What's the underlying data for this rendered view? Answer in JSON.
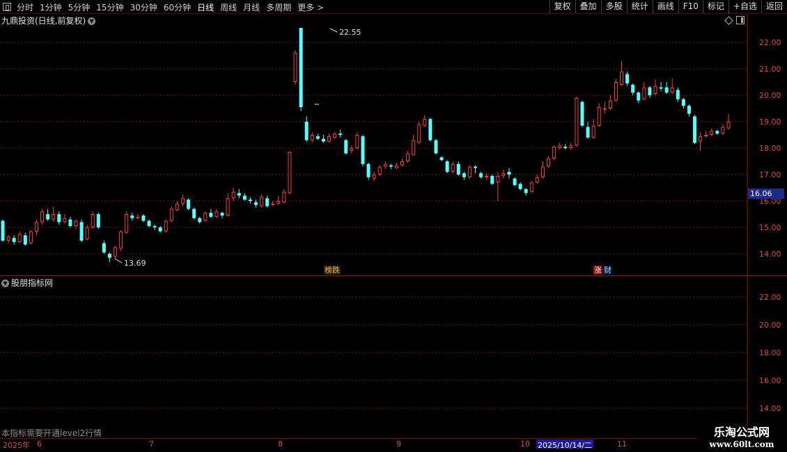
{
  "toolbar": {
    "items": [
      "分时",
      "1分钟",
      "5分钟",
      "15分钟",
      "30分钟",
      "60分钟",
      "日线",
      "周线",
      "月线",
      "多周期",
      "更多 >"
    ],
    "active_index": 6,
    "right_buttons": [
      "复权",
      "叠加",
      "多股",
      "统计",
      "画线",
      "F10",
      "标记",
      "+自选",
      "返回"
    ]
  },
  "main_chart": {
    "title": "九鼎投资(日线,前复权)",
    "y_axis_labels": [
      "22.00",
      "21.00",
      "20.00",
      "19.00",
      "18.00",
      "17.00",
      "16.00",
      "15.00",
      "14.00"
    ],
    "current_price_label": "16.06",
    "high_label": "22.55",
    "low_label": "13.69",
    "tag_bang": "榜跌",
    "tag_zhang": "涨",
    "tag_cai": "财"
  },
  "indicator": {
    "title": "股朋指标网",
    "y_axis_labels": [
      "22.00",
      "20.00",
      "18.00",
      "16.00",
      "14.00"
    ],
    "notice": "本指标需要开通level2行情"
  },
  "date_axis": {
    "year_label": "2025年",
    "months": [
      "6",
      "7",
      "8",
      "9",
      "10",
      "11"
    ],
    "highlight_date": "2025/10/14/二"
  },
  "watermark": {
    "line1": "乐淘公式网",
    "line2": "www.60lt.com"
  },
  "colors": {
    "up": "#ff3b3b",
    "down": "#54ffff",
    "grid": "#7a1010",
    "axis_text": "#e04040"
  },
  "chart_data": {
    "type": "candlestick",
    "ylim": [
      13.3,
      23.0
    ],
    "candles": [
      [
        15.25,
        14.5,
        15.3,
        14.45
      ],
      [
        14.5,
        14.65,
        14.7,
        14.4
      ],
      [
        14.6,
        14.45,
        14.7,
        14.35
      ],
      [
        14.45,
        14.75,
        14.85,
        14.4
      ],
      [
        14.7,
        14.35,
        14.8,
        14.3
      ],
      [
        14.4,
        14.85,
        14.9,
        14.35
      ],
      [
        14.85,
        15.2,
        15.3,
        14.7
      ],
      [
        15.2,
        15.6,
        15.7,
        15.1
      ],
      [
        15.5,
        15.3,
        15.7,
        15.25
      ],
      [
        15.3,
        15.5,
        15.8,
        15.2
      ],
      [
        15.5,
        15.2,
        15.6,
        15.1
      ],
      [
        15.2,
        15.35,
        15.5,
        15.15
      ],
      [
        15.3,
        15.05,
        15.4,
        15.0
      ],
      [
        15.05,
        15.25,
        15.3,
        14.95
      ],
      [
        15.2,
        14.5,
        15.3,
        14.45
      ],
      [
        14.55,
        15.0,
        15.1,
        14.5
      ],
      [
        15.0,
        15.5,
        15.6,
        14.95
      ],
      [
        15.5,
        15.0,
        15.55,
        14.95
      ],
      [
        14.4,
        14.05,
        14.5,
        14.0
      ],
      [
        14.0,
        13.85,
        14.05,
        13.69
      ],
      [
        13.9,
        14.25,
        14.3,
        13.8
      ],
      [
        14.2,
        14.85,
        14.9,
        14.1
      ],
      [
        14.8,
        15.5,
        15.6,
        14.75
      ],
      [
        15.45,
        15.35,
        15.55,
        15.25
      ],
      [
        15.35,
        15.4,
        15.5,
        15.3
      ],
      [
        15.45,
        15.25,
        15.5,
        15.2
      ],
      [
        15.25,
        15.05,
        15.3,
        15.0
      ],
      [
        15.05,
        15.0,
        15.1,
        14.9
      ],
      [
        15.0,
        14.85,
        15.05,
        14.8
      ],
      [
        14.85,
        15.25,
        15.3,
        14.8
      ],
      [
        15.25,
        15.7,
        15.8,
        15.2
      ],
      [
        15.65,
        15.9,
        16.0,
        15.6
      ],
      [
        15.9,
        16.1,
        16.25,
        15.8
      ],
      [
        16.05,
        15.7,
        16.1,
        15.65
      ],
      [
        15.7,
        15.35,
        15.75,
        15.3
      ],
      [
        15.35,
        15.2,
        15.4,
        15.15
      ],
      [
        15.25,
        15.55,
        15.6,
        15.2
      ],
      [
        15.55,
        15.4,
        15.7,
        15.35
      ],
      [
        15.4,
        15.6,
        15.7,
        15.35
      ],
      [
        15.55,
        15.45,
        15.6,
        15.35
      ],
      [
        15.45,
        16.1,
        16.3,
        15.4
      ],
      [
        16.1,
        16.35,
        16.5,
        16.0
      ],
      [
        16.3,
        16.2,
        16.45,
        16.1
      ],
      [
        16.2,
        16.05,
        16.3,
        16.0
      ],
      [
        16.05,
        16.0,
        16.15,
        15.9
      ],
      [
        15.95,
        15.85,
        16.05,
        15.75
      ],
      [
        15.8,
        16.15,
        16.25,
        15.75
      ],
      [
        16.1,
        15.8,
        16.2,
        15.75
      ],
      [
        15.85,
        15.9,
        16.0,
        15.8
      ],
      [
        15.9,
        16.0,
        16.2,
        15.85
      ],
      [
        15.95,
        16.35,
        16.45,
        15.9
      ],
      [
        16.3,
        17.85,
        17.9,
        16.25
      ],
      [
        20.5,
        21.6,
        21.7,
        20.4
      ],
      [
        22.55,
        19.55,
        22.55,
        19.4
      ],
      [
        19.0,
        18.3,
        19.2,
        18.25
      ],
      [
        18.3,
        18.5,
        18.6,
        18.2
      ],
      [
        18.45,
        18.35,
        18.55,
        18.3
      ],
      [
        18.35,
        18.25,
        18.5,
        18.2
      ],
      [
        18.25,
        18.45,
        18.55,
        18.2
      ],
      [
        18.4,
        18.55,
        18.6,
        18.35
      ],
      [
        18.55,
        18.5,
        18.7,
        18.4
      ],
      [
        18.3,
        17.8,
        18.35,
        17.75
      ],
      [
        17.9,
        18.0,
        18.1,
        17.8
      ],
      [
        18.0,
        18.5,
        18.6,
        17.95
      ],
      [
        18.45,
        17.4,
        18.5,
        17.3
      ],
      [
        17.4,
        16.9,
        17.45,
        16.8
      ],
      [
        16.85,
        17.0,
        17.1,
        16.75
      ],
      [
        17.0,
        17.3,
        17.35,
        16.95
      ],
      [
        17.3,
        17.4,
        17.5,
        17.2
      ],
      [
        17.35,
        17.3,
        17.4,
        17.2
      ],
      [
        17.25,
        17.35,
        17.45,
        17.2
      ],
      [
        17.35,
        17.5,
        17.6,
        17.3
      ],
      [
        17.5,
        17.8,
        17.9,
        17.45
      ],
      [
        17.75,
        18.3,
        18.5,
        17.7
      ],
      [
        18.2,
        18.9,
        19.0,
        18.15
      ],
      [
        18.85,
        19.1,
        19.25,
        18.8
      ],
      [
        19.1,
        18.3,
        19.15,
        18.25
      ],
      [
        18.3,
        17.8,
        18.35,
        17.75
      ],
      [
        17.65,
        17.55,
        17.7,
        17.5
      ],
      [
        17.5,
        17.1,
        17.55,
        17.05
      ],
      [
        17.1,
        17.4,
        17.5,
        17.05
      ],
      [
        17.4,
        17.0,
        17.5,
        16.95
      ],
      [
        17.05,
        16.9,
        17.1,
        16.8
      ],
      [
        16.9,
        17.3,
        17.35,
        16.85
      ],
      [
        17.3,
        17.25,
        17.35,
        17.05
      ],
      [
        17.05,
        16.9,
        17.1,
        16.85
      ],
      [
        16.9,
        16.95,
        17.05,
        16.8
      ],
      [
        16.95,
        16.65,
        17.0,
        16.6
      ],
      [
        16.7,
        16.95,
        17.1,
        16.0
      ],
      [
        16.95,
        17.05,
        17.2,
        16.85
      ],
      [
        17.1,
        17.0,
        17.25,
        16.85
      ],
      [
        16.85,
        16.6,
        16.9,
        16.55
      ],
      [
        16.65,
        16.45,
        16.7,
        16.4
      ],
      [
        16.45,
        16.3,
        16.5,
        16.2
      ],
      [
        16.35,
        16.7,
        16.75,
        16.3
      ],
      [
        16.7,
        16.9,
        17.0,
        16.65
      ],
      [
        16.9,
        17.3,
        17.5,
        16.85
      ],
      [
        17.3,
        17.6,
        17.7,
        17.25
      ],
      [
        17.6,
        18.05,
        18.1,
        17.55
      ],
      [
        18.0,
        18.1,
        18.2,
        17.95
      ],
      [
        18.05,
        18.0,
        18.15,
        17.95
      ],
      [
        18.0,
        18.1,
        18.2,
        17.95
      ],
      [
        18.1,
        19.9,
        19.95,
        18.05
      ],
      [
        19.75,
        18.85,
        19.8,
        18.8
      ],
      [
        18.8,
        18.4,
        19.0,
        18.35
      ],
      [
        18.4,
        18.85,
        19.1,
        18.35
      ],
      [
        18.85,
        19.55,
        19.7,
        18.8
      ],
      [
        19.5,
        19.5,
        19.75,
        19.3
      ],
      [
        19.5,
        19.8,
        20.0,
        19.45
      ],
      [
        19.8,
        20.5,
        20.6,
        19.75
      ],
      [
        20.4,
        20.9,
        21.3,
        20.35
      ],
      [
        20.8,
        20.45,
        20.9,
        20.35
      ],
      [
        20.4,
        20.1,
        20.45,
        20.0
      ],
      [
        20.1,
        19.8,
        20.15,
        19.7
      ],
      [
        19.85,
        20.3,
        20.5,
        19.8
      ],
      [
        20.3,
        20.0,
        20.35,
        19.9
      ],
      [
        20.05,
        20.35,
        20.6,
        20.0
      ],
      [
        20.3,
        20.25,
        20.5,
        20.15
      ],
      [
        20.3,
        20.1,
        20.5,
        20.05
      ],
      [
        20.1,
        20.3,
        20.65,
        20.05
      ],
      [
        20.2,
        19.85,
        20.3,
        19.75
      ],
      [
        19.85,
        19.6,
        19.9,
        19.5
      ],
      [
        19.6,
        19.3,
        19.65,
        19.2
      ],
      [
        19.2,
        18.2,
        19.25,
        18.15
      ],
      [
        18.25,
        18.45,
        18.6,
        17.9
      ],
      [
        18.45,
        18.5,
        18.65,
        18.4
      ],
      [
        18.5,
        18.65,
        18.75,
        18.45
      ],
      [
        18.65,
        18.55,
        18.7,
        18.5
      ],
      [
        18.55,
        18.8,
        18.9,
        18.5
      ],
      [
        18.75,
        19.0,
        19.3,
        18.7
      ]
    ]
  }
}
